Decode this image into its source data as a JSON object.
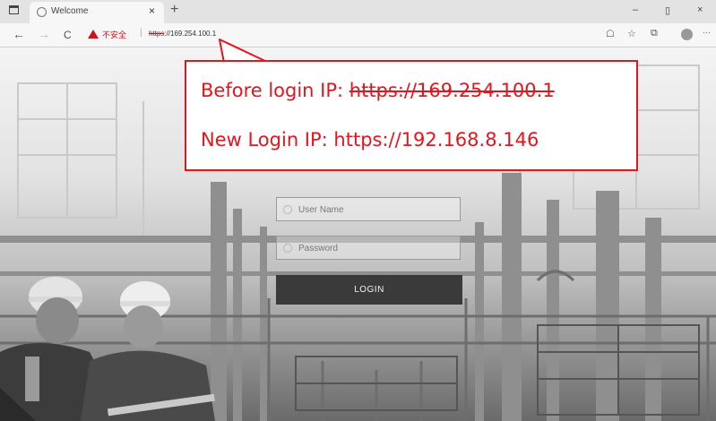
{
  "browser": {
    "tab_title": "Welcome",
    "tab_close": "×",
    "new_tab": "+",
    "window_minimize": "–",
    "window_restore": "▯",
    "window_close": "×",
    "nav_back": "←",
    "nav_forward": "→",
    "nav_reload": "C",
    "security_warning": "不安全",
    "url_protocol": "https",
    "url_rest": "://169.254.100.1",
    "more_menu": "···"
  },
  "login": {
    "username_placeholder": "User Name",
    "password_placeholder": "Password",
    "button_label": "LOGIN"
  },
  "annotation": {
    "before_label": "Before login IP: ",
    "before_ip": "https://169.254.100.1",
    "new_line": "New Login IP: https://192.168.8.146"
  },
  "colors": {
    "annotation_red": "#e8141c",
    "login_button": "#3a3a3a",
    "security_warning": "#d0101a"
  }
}
